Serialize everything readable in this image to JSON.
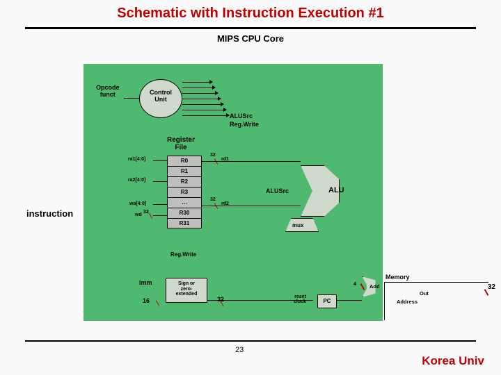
{
  "title": "Schematic with Instruction Execution #1",
  "subtitle": "MIPS CPU Core",
  "control_unit": "Control\nUnit",
  "opcode": "Opcode\nfunct",
  "signals": {
    "alusrc": "ALUSrc",
    "regwrite": "Reg.Write"
  },
  "register_file_label": "Register\nFile",
  "registers": [
    "R0",
    "R1",
    "R2",
    "R3",
    "…",
    "R30",
    "R31"
  ],
  "ports": {
    "ra1": "ra1[4:0]",
    "ra2": "ra2[4:0]",
    "wa": "wa[4:0]",
    "wd": "wd"
  },
  "buswidth": {
    "w32": "32",
    "w16": "16"
  },
  "rd": {
    "rd1": "rd1",
    "rd2": "rd2"
  },
  "alu_label": "ALU",
  "alusrc_lbl": "ALUSrc",
  "mux_label": "mux",
  "regwrite_lbl": "Reg.Write",
  "imm_label": "imm",
  "ext_label": "Sign or\nzero-\nextended",
  "pc_label": "PC",
  "reset_clock": "reset\nclock",
  "add_label": "Add",
  "mem_label": "Memory",
  "address_label": "Address",
  "out_label": "Out",
  "four_label": "4",
  "instruction_label": "instruction",
  "page_number": "23",
  "footer": "Korea Univ",
  "right32": "32"
}
